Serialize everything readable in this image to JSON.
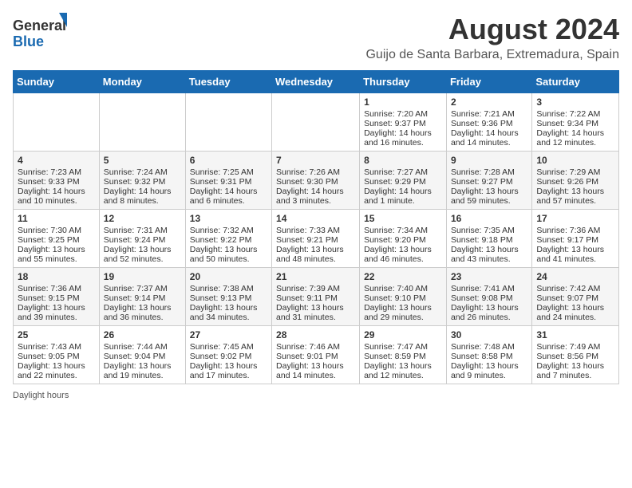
{
  "header": {
    "logo_general": "General",
    "logo_blue": "Blue",
    "title": "August 2024",
    "subtitle": "Guijo de Santa Barbara, Extremadura, Spain"
  },
  "columns": [
    "Sunday",
    "Monday",
    "Tuesday",
    "Wednesday",
    "Thursday",
    "Friday",
    "Saturday"
  ],
  "weeks": [
    [
      {
        "day": "",
        "info": ""
      },
      {
        "day": "",
        "info": ""
      },
      {
        "day": "",
        "info": ""
      },
      {
        "day": "",
        "info": ""
      },
      {
        "day": "1",
        "info": "Sunrise: 7:20 AM\nSunset: 9:37 PM\nDaylight: 14 hours and 16 minutes."
      },
      {
        "day": "2",
        "info": "Sunrise: 7:21 AM\nSunset: 9:36 PM\nDaylight: 14 hours and 14 minutes."
      },
      {
        "day": "3",
        "info": "Sunrise: 7:22 AM\nSunset: 9:34 PM\nDaylight: 14 hours and 12 minutes."
      }
    ],
    [
      {
        "day": "4",
        "info": "Sunrise: 7:23 AM\nSunset: 9:33 PM\nDaylight: 14 hours and 10 minutes."
      },
      {
        "day": "5",
        "info": "Sunrise: 7:24 AM\nSunset: 9:32 PM\nDaylight: 14 hours and 8 minutes."
      },
      {
        "day": "6",
        "info": "Sunrise: 7:25 AM\nSunset: 9:31 PM\nDaylight: 14 hours and 6 minutes."
      },
      {
        "day": "7",
        "info": "Sunrise: 7:26 AM\nSunset: 9:30 PM\nDaylight: 14 hours and 3 minutes."
      },
      {
        "day": "8",
        "info": "Sunrise: 7:27 AM\nSunset: 9:29 PM\nDaylight: 14 hours and 1 minute."
      },
      {
        "day": "9",
        "info": "Sunrise: 7:28 AM\nSunset: 9:27 PM\nDaylight: 13 hours and 59 minutes."
      },
      {
        "day": "10",
        "info": "Sunrise: 7:29 AM\nSunset: 9:26 PM\nDaylight: 13 hours and 57 minutes."
      }
    ],
    [
      {
        "day": "11",
        "info": "Sunrise: 7:30 AM\nSunset: 9:25 PM\nDaylight: 13 hours and 55 minutes."
      },
      {
        "day": "12",
        "info": "Sunrise: 7:31 AM\nSunset: 9:24 PM\nDaylight: 13 hours and 52 minutes."
      },
      {
        "day": "13",
        "info": "Sunrise: 7:32 AM\nSunset: 9:22 PM\nDaylight: 13 hours and 50 minutes."
      },
      {
        "day": "14",
        "info": "Sunrise: 7:33 AM\nSunset: 9:21 PM\nDaylight: 13 hours and 48 minutes."
      },
      {
        "day": "15",
        "info": "Sunrise: 7:34 AM\nSunset: 9:20 PM\nDaylight: 13 hours and 46 minutes."
      },
      {
        "day": "16",
        "info": "Sunrise: 7:35 AM\nSunset: 9:18 PM\nDaylight: 13 hours and 43 minutes."
      },
      {
        "day": "17",
        "info": "Sunrise: 7:36 AM\nSunset: 9:17 PM\nDaylight: 13 hours and 41 minutes."
      }
    ],
    [
      {
        "day": "18",
        "info": "Sunrise: 7:36 AM\nSunset: 9:15 PM\nDaylight: 13 hours and 39 minutes."
      },
      {
        "day": "19",
        "info": "Sunrise: 7:37 AM\nSunset: 9:14 PM\nDaylight: 13 hours and 36 minutes."
      },
      {
        "day": "20",
        "info": "Sunrise: 7:38 AM\nSunset: 9:13 PM\nDaylight: 13 hours and 34 minutes."
      },
      {
        "day": "21",
        "info": "Sunrise: 7:39 AM\nSunset: 9:11 PM\nDaylight: 13 hours and 31 minutes."
      },
      {
        "day": "22",
        "info": "Sunrise: 7:40 AM\nSunset: 9:10 PM\nDaylight: 13 hours and 29 minutes."
      },
      {
        "day": "23",
        "info": "Sunrise: 7:41 AM\nSunset: 9:08 PM\nDaylight: 13 hours and 26 minutes."
      },
      {
        "day": "24",
        "info": "Sunrise: 7:42 AM\nSunset: 9:07 PM\nDaylight: 13 hours and 24 minutes."
      }
    ],
    [
      {
        "day": "25",
        "info": "Sunrise: 7:43 AM\nSunset: 9:05 PM\nDaylight: 13 hours and 22 minutes."
      },
      {
        "day": "26",
        "info": "Sunrise: 7:44 AM\nSunset: 9:04 PM\nDaylight: 13 hours and 19 minutes."
      },
      {
        "day": "27",
        "info": "Sunrise: 7:45 AM\nSunset: 9:02 PM\nDaylight: 13 hours and 17 minutes."
      },
      {
        "day": "28",
        "info": "Sunrise: 7:46 AM\nSunset: 9:01 PM\nDaylight: 13 hours and 14 minutes."
      },
      {
        "day": "29",
        "info": "Sunrise: 7:47 AM\nSunset: 8:59 PM\nDaylight: 13 hours and 12 minutes."
      },
      {
        "day": "30",
        "info": "Sunrise: 7:48 AM\nSunset: 8:58 PM\nDaylight: 13 hours and 9 minutes."
      },
      {
        "day": "31",
        "info": "Sunrise: 7:49 AM\nSunset: 8:56 PM\nDaylight: 13 hours and 7 minutes."
      }
    ]
  ],
  "footer": "Daylight hours"
}
